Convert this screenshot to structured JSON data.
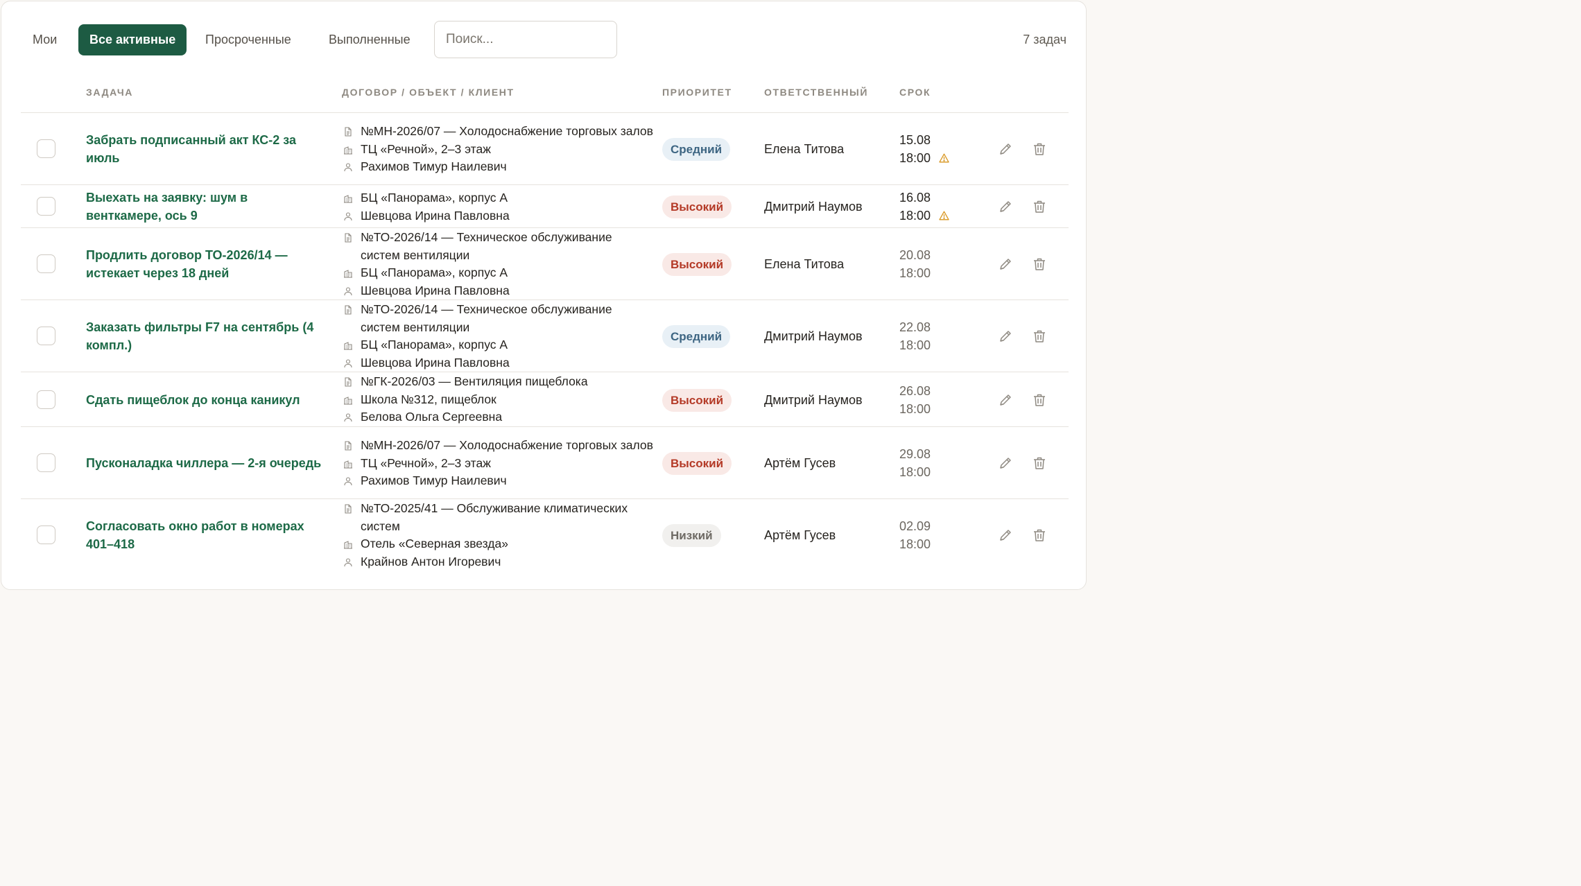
{
  "filters": {
    "tabs": [
      "Мои",
      "Все активные",
      "Просроченные",
      "Выполненные"
    ],
    "active_tab": "Все активные",
    "search_placeholder": "Поиск...",
    "count_label": "7 задач"
  },
  "table": {
    "headers": [
      "ЗАДАЧА",
      "ДОГОВОР / ОБЪЕКТ / КЛИЕНТ",
      "ПРИОРИТЕТ",
      "ОТВЕТСТВЕННЫЙ",
      "СРОК"
    ],
    "rows": [
      {
        "title": "Забрать подписанный акт КС-2 за июль",
        "contract": "№МН-2026/07 — Холодоснабжение торговых залов",
        "object": "ТЦ «Речной», 2–3 этаж",
        "client": "Рахимов Тимур Наилевич",
        "priority": "Средний",
        "responsible": "Елена Титова",
        "due_date": "15.08",
        "due_time": "18:00",
        "overdue_warning": true
      },
      {
        "title": "Выехать на заявку: шум в венткамере, ось 9",
        "contract": "",
        "object": "БЦ «Панорама», корпус А",
        "client": "Шевцова Ирина Павловна",
        "priority": "Высокий",
        "responsible": "Дмитрий Наумов",
        "due_date": "16.08",
        "due_time": "18:00",
        "overdue_warning": true
      },
      {
        "title": "Продлить договор ТО-2026/14 — истекает через 18 дней",
        "contract": "№ТО-2026/14 — Техническое обслуживание систем вентиляции",
        "object": "БЦ «Панорама», корпус А",
        "client": "Шевцова Ирина Павловна",
        "priority": "Высокий",
        "responsible": "Елена Титова",
        "due_date": "20.08",
        "due_time": "18:00",
        "overdue_warning": false
      },
      {
        "title": "Заказать фильтры F7 на сентябрь (4 компл.)",
        "contract": "№ТО-2026/14 — Техническое обслуживание систем вентиляции",
        "object": "БЦ «Панорама», корпус А",
        "client": "Шевцова Ирина Павловна",
        "priority": "Средний",
        "responsible": "Дмитрий Наумов",
        "due_date": "22.08",
        "due_time": "18:00",
        "overdue_warning": false
      },
      {
        "title": "Сдать пищеблок до конца каникул",
        "contract": "№ГК-2026/03 — Вентиляция пищеблока",
        "object": "Школа №312, пищеблок",
        "client": "Белова Ольга Сергеевна",
        "priority": "Высокий",
        "responsible": "Дмитрий Наумов",
        "due_date": "26.08",
        "due_time": "18:00",
        "overdue_warning": false
      },
      {
        "title": "Пусконаладка чиллера — 2-я очередь",
        "contract": "№МН-2026/07 — Холодоснабжение торговых залов",
        "object": "ТЦ «Речной», 2–3 этаж",
        "client": "Рахимов Тимур Наилевич",
        "priority": "Высокий",
        "responsible": "Артём Гусев",
        "due_date": "29.08",
        "due_time": "18:00",
        "overdue_warning": false
      },
      {
        "title": "Согласовать окно работ в номерах 401–418",
        "contract": "№ТО-2025/41 — Обслуживание климатических систем",
        "object": "Отель «Северная звезда»",
        "client": "Крайнов Антон Игоревич",
        "priority": "Низкий",
        "responsible": "Артём Гусев",
        "due_date": "02.09",
        "due_time": "18:00",
        "overdue_warning": false
      }
    ]
  },
  "colors": {
    "accent": "#1d5b43",
    "title_green": "#1d6a47",
    "priority_high": "#b43a27",
    "priority_medium": "#3d6582",
    "priority_low": "#6e6a64",
    "warning": "#d8961f"
  },
  "icons": {
    "contract": "document-icon",
    "object": "building-icon",
    "client": "person-icon",
    "warning": "warning-triangle-icon",
    "edit": "pencil-icon",
    "delete": "trash-icon"
  }
}
